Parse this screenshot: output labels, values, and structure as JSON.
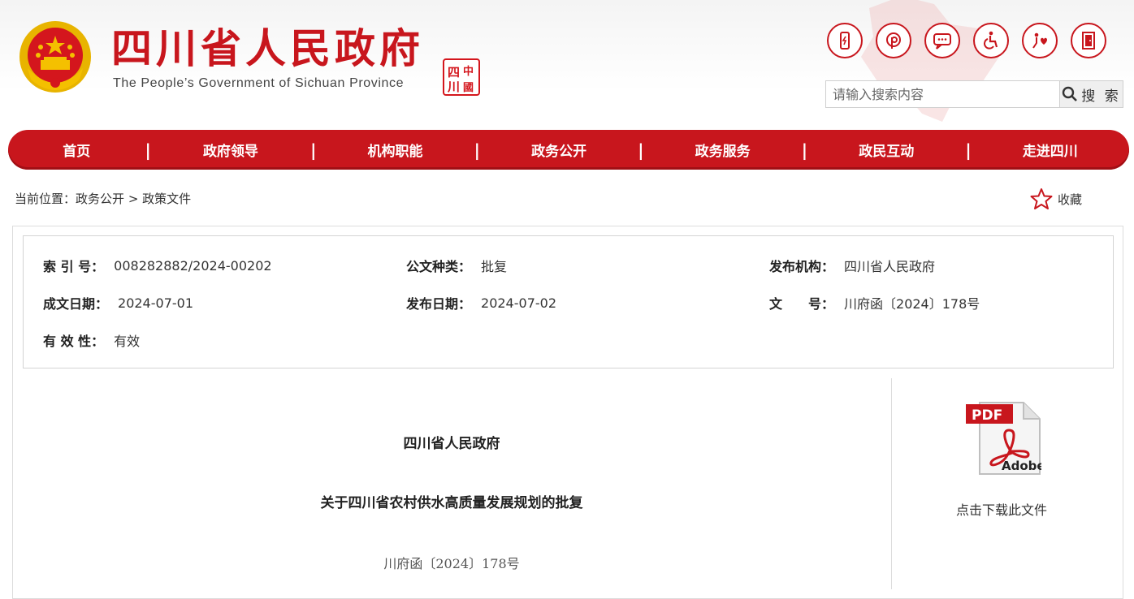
{
  "header": {
    "title": "四川省人民政府",
    "subtitle": "The People’s Government of Sichuan Province",
    "seal_text": "四川中国"
  },
  "tools": [
    {
      "name": "mobile-icon"
    },
    {
      "name": "weibo-icon"
    },
    {
      "name": "message-icon"
    },
    {
      "name": "accessibility-icon"
    },
    {
      "name": "elderly-care-icon"
    },
    {
      "name": "exit-icon"
    }
  ],
  "search": {
    "placeholder": "请输入搜索内容",
    "button_label": "搜 索"
  },
  "nav": {
    "items": [
      "首页",
      "政府领导",
      "机构职能",
      "政务公开",
      "政务服务",
      "政民互动",
      "走进四川"
    ],
    "separator": "|"
  },
  "breadcrumb": {
    "prefix": "当前位置：",
    "items": [
      "政务公开",
      "政策文件"
    ],
    "separator": ">"
  },
  "favorite": {
    "label": "收藏"
  },
  "meta": {
    "index_label": "索 引 号：",
    "index_value": "008282882/2024-00202",
    "type_label": "公文种类：",
    "type_value": "批复",
    "publisher_label": "发布机构：",
    "publisher_value": "四川省人民政府",
    "created_label": "成文日期：",
    "created_value": "2024-07-01",
    "published_label": "发布日期：",
    "published_value": "2024-07-02",
    "docno_label": "文　　号：",
    "docno_value": "川府函〔2024〕178号",
    "validity_label": "有 效 性：",
    "validity_value": "有效"
  },
  "document": {
    "issuer": "四川省人民政府",
    "title": "关于四川省农村供水高质量发展规划的批复",
    "number": "川府函〔2024〕178号"
  },
  "download": {
    "pdf_badge": "PDF",
    "brand": "Adobe",
    "label": "点击下载此文件"
  },
  "colors": {
    "brand_red": "#c8161d",
    "emblem_gold": "#f4c000"
  }
}
